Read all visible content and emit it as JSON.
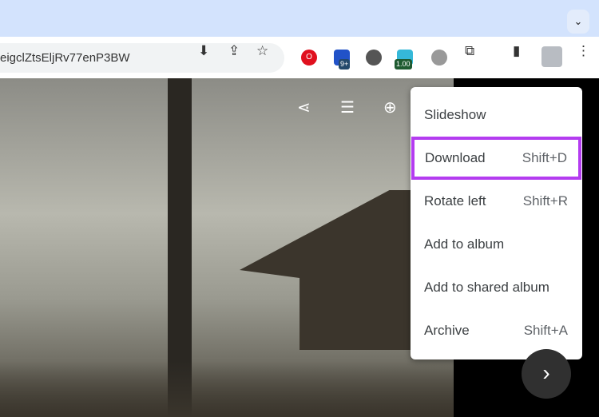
{
  "browser": {
    "url": "eigclZtsEljRv77enP3BW",
    "tab_dropdown": "⌄",
    "ext_badge_1": "9+",
    "ext_badge_2": "1.00"
  },
  "menu": {
    "items": [
      {
        "label": "Slideshow",
        "shortcut": ""
      },
      {
        "label": "Download",
        "shortcut": "Shift+D"
      },
      {
        "label": "Rotate left",
        "shortcut": "Shift+R"
      },
      {
        "label": "Add to album",
        "shortcut": ""
      },
      {
        "label": "Add to shared album",
        "shortcut": ""
      },
      {
        "label": "Archive",
        "shortcut": "Shift+A"
      }
    ],
    "highlight_color": "#b43cf0"
  },
  "viewer": {
    "next": "›"
  }
}
